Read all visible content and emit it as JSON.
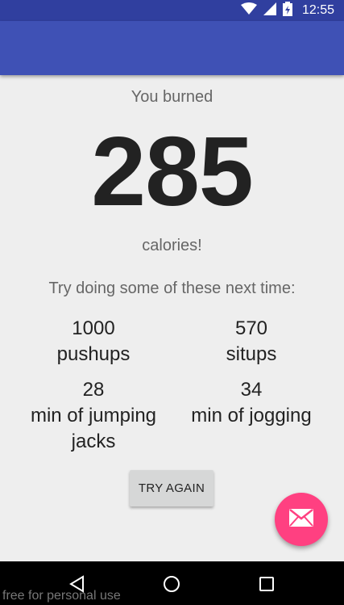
{
  "status_bar": {
    "time": "12:55",
    "icons": [
      "wifi-icon",
      "signal-icon",
      "battery-icon"
    ]
  },
  "result": {
    "burned_label": "You burned",
    "calories": "285",
    "calories_suffix": "calories!",
    "suggestion": "Try doing some of these next time:"
  },
  "exercises": [
    {
      "amount": "1000",
      "name": "pushups"
    },
    {
      "amount": "570",
      "name": "situps"
    },
    {
      "amount": "28",
      "name": "min of jumping jacks"
    },
    {
      "amount": "34",
      "name": "min of jogging"
    }
  ],
  "try_again_label": "TRY AGAIN",
  "fab": {
    "icon": "mail-icon"
  },
  "nav_bar": {
    "icons": [
      "back-icon",
      "home-icon",
      "recents-icon"
    ]
  },
  "watermark": "free for personal use",
  "colors": {
    "status_bar": "#303f9f",
    "app_bar": "#3f51b5",
    "fab": "#ff4081",
    "background": "#eeeeee"
  }
}
